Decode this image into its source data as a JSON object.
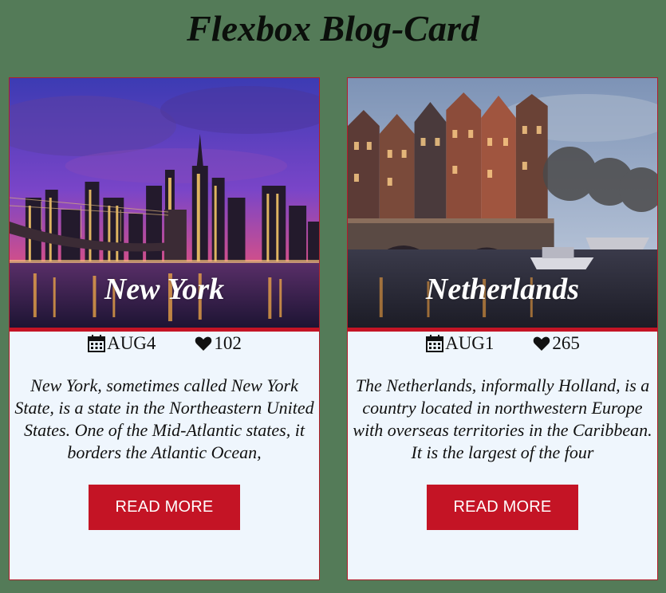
{
  "page": {
    "title": "Flexbox Blog-Card"
  },
  "cards": [
    {
      "title": "New York",
      "date": "AUG4",
      "likes": "102",
      "excerpt": "New York, sometimes called New York State, is a state in the Northeastern United States. One of the Mid-Atlantic states, it borders the Atlantic Ocean,",
      "button": "READ MORE",
      "image_icon": "new-york-skyline-photo"
    },
    {
      "title": "Netherlands",
      "date": "AUG1",
      "likes": "265",
      "excerpt": "The Netherlands, informally Holland, is a country located in northwestern Europe with overseas territories in the Caribbean. It is the largest of the four",
      "button": "READ MORE",
      "image_icon": "amsterdam-canal-photo"
    }
  ],
  "icons": {
    "date": "calendar-icon",
    "likes": "heart-icon"
  },
  "colors": {
    "background": "#547b58",
    "card_background": "#eff6fd",
    "accent": "#c41425",
    "card_border": "#b21d2b"
  }
}
